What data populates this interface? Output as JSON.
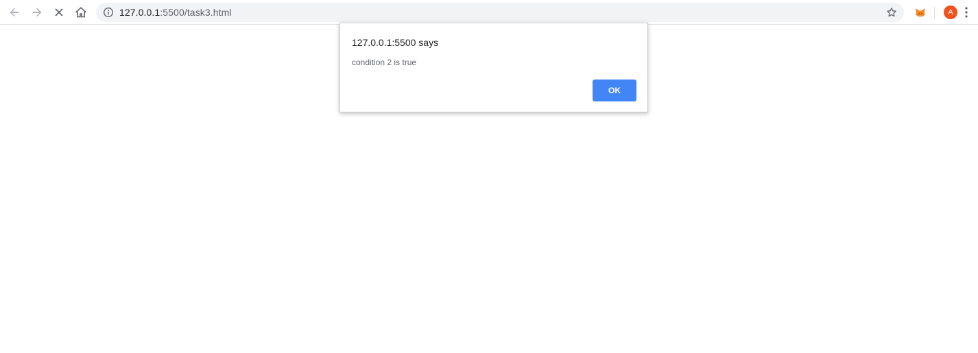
{
  "browser": {
    "toolbar": {
      "back_icon": "arrow-left-icon",
      "forward_icon": "arrow-right-icon",
      "stop_icon": "close-icon",
      "home_icon": "home-icon"
    },
    "omnibox": {
      "info_icon": "info-icon",
      "url_host": "127.0.0.1",
      "url_rest": ":5500/task3.html",
      "bookmark_icon": "star-icon"
    },
    "extensions": {
      "extension_icon": "fox-extension-icon"
    },
    "profile": {
      "avatar_letter": "A",
      "avatar_color": "#f4511e"
    },
    "menu_icon": "vertical-dots-icon"
  },
  "dialog": {
    "title": "127.0.0.1:5500 says",
    "message": "condition 2 is true",
    "ok_label": "OK",
    "ok_color": "#4285f4"
  }
}
